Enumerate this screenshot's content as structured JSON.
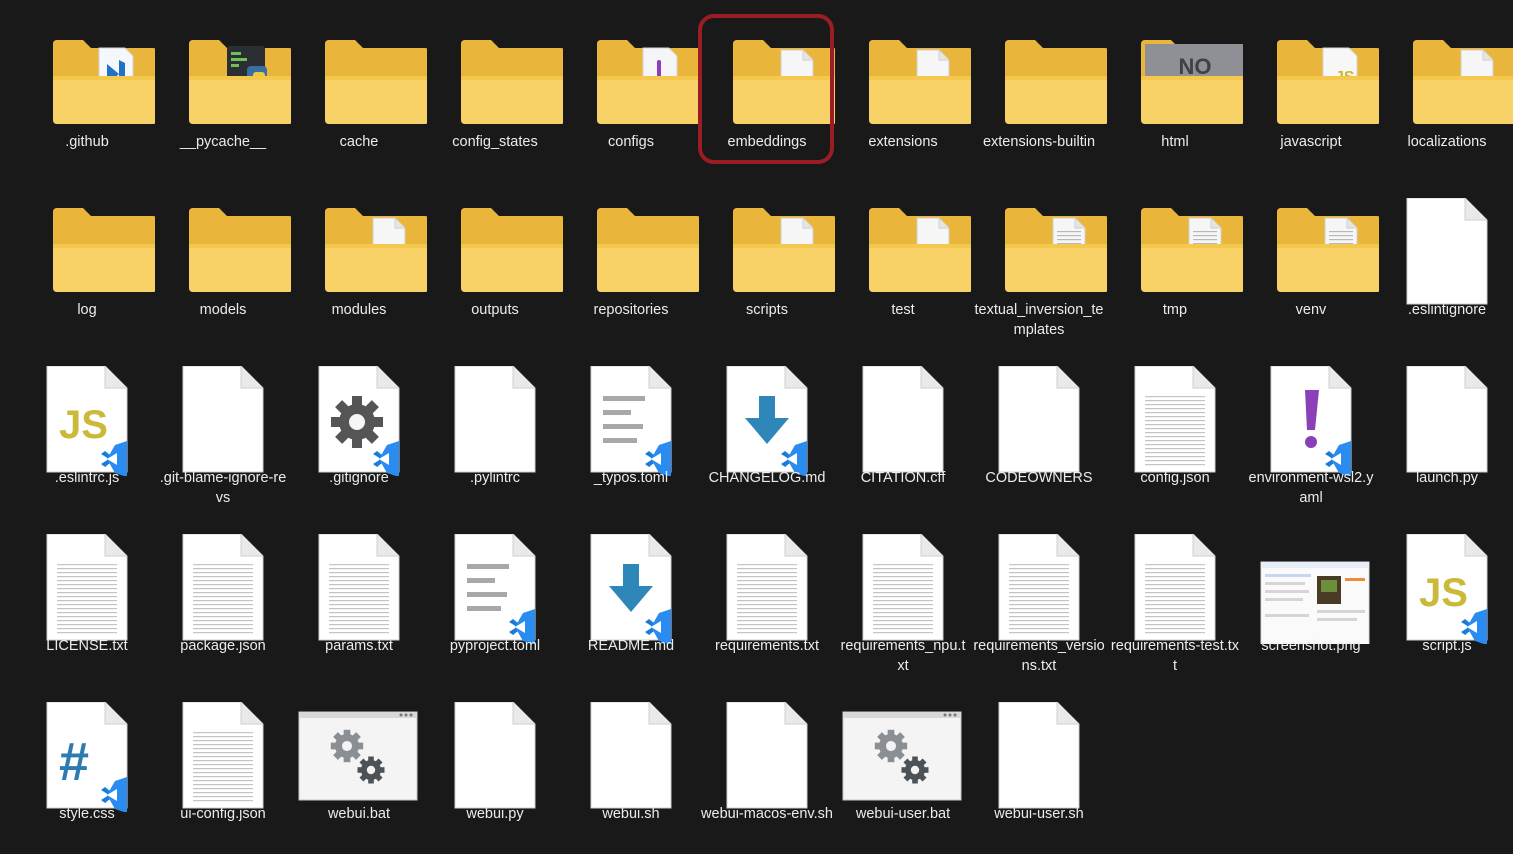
{
  "explorer": {
    "selected_item": "embeddings",
    "accent_ring_color": "#9b1c25",
    "items": [
      {
        "label": ".github",
        "icon": "folder-github-icon",
        "kind": "folder",
        "content": "vscode"
      },
      {
        "label": "__pycache__",
        "icon": "folder-pycache-icon",
        "kind": "folder",
        "content": "python"
      },
      {
        "label": "cache",
        "icon": "folder-icon",
        "kind": "folder",
        "content": "empty"
      },
      {
        "label": "config_states",
        "icon": "folder-icon",
        "kind": "folder",
        "content": "empty"
      },
      {
        "label": "configs",
        "icon": "folder-configs-icon",
        "kind": "folder",
        "content": "purple"
      },
      {
        "label": "embeddings",
        "icon": "folder-doc-icon",
        "kind": "folder",
        "content": "doc"
      },
      {
        "label": "extensions",
        "icon": "folder-doc-icon",
        "kind": "folder",
        "content": "doc"
      },
      {
        "label": "extensions-builtin",
        "icon": "folder-icon",
        "kind": "folder",
        "content": "empty"
      },
      {
        "label": "html",
        "icon": "folder-html-icon",
        "kind": "folder",
        "content": "no-image"
      },
      {
        "label": "javascript",
        "icon": "folder-js-icon",
        "kind": "folder",
        "content": "js"
      },
      {
        "label": "localizations",
        "icon": "folder-doc-icon",
        "kind": "folder",
        "content": "doc"
      },
      {
        "label": "log",
        "icon": "folder-icon",
        "kind": "folder",
        "content": "empty"
      },
      {
        "label": "models",
        "icon": "folder-icon",
        "kind": "folder",
        "content": "empty"
      },
      {
        "label": "modules",
        "icon": "folder-doc-icon",
        "kind": "folder",
        "content": "doc"
      },
      {
        "label": "outputs",
        "icon": "folder-icon",
        "kind": "folder",
        "content": "empty"
      },
      {
        "label": "repositories",
        "icon": "folder-icon",
        "kind": "folder",
        "content": "empty"
      },
      {
        "label": "scripts",
        "icon": "folder-doc-icon",
        "kind": "folder",
        "content": "doc"
      },
      {
        "label": "test",
        "icon": "folder-doc-icon",
        "kind": "folder",
        "content": "doc"
      },
      {
        "label": "textual_inversion_templates",
        "icon": "folder-doc-icon",
        "kind": "folder",
        "content": "lines"
      },
      {
        "label": "tmp",
        "icon": "folder-doc-icon",
        "kind": "folder",
        "content": "lines"
      },
      {
        "label": "venv",
        "icon": "folder-doc-icon",
        "kind": "folder",
        "content": "lines"
      },
      {
        "label": ".eslintignore",
        "icon": "blank-file-icon",
        "kind": "file",
        "content": "blank"
      },
      {
        "label": ".eslintrc.js",
        "icon": "js-file-icon",
        "kind": "file",
        "content": "js"
      },
      {
        "label": ".git-blame-ignore-revs",
        "icon": "blank-file-icon",
        "kind": "file",
        "content": "blank"
      },
      {
        "label": ".gitignore",
        "icon": "gear-file-icon",
        "kind": "file",
        "content": "gear"
      },
      {
        "label": ".pylintrc",
        "icon": "blank-file-icon",
        "kind": "file",
        "content": "blank"
      },
      {
        "label": "_typos.toml",
        "icon": "text-file-icon",
        "kind": "file",
        "content": "text"
      },
      {
        "label": "CHANGELOG.md",
        "icon": "markdown-file-icon",
        "kind": "file",
        "content": "download"
      },
      {
        "label": "CITATION.cff",
        "icon": "blank-file-icon",
        "kind": "file",
        "content": "blank"
      },
      {
        "label": "CODEOWNERS",
        "icon": "blank-file-icon",
        "kind": "file",
        "content": "blank"
      },
      {
        "label": "config.json",
        "icon": "lined-file-icon",
        "kind": "file",
        "content": "lines"
      },
      {
        "label": "environment-wsl2.yaml",
        "icon": "yaml-file-icon",
        "kind": "file",
        "content": "exclaim"
      },
      {
        "label": "launch.py",
        "icon": "blank-file-icon",
        "kind": "file",
        "content": "blank"
      },
      {
        "label": "LICENSE.txt",
        "icon": "lined-file-icon",
        "kind": "file",
        "content": "lines"
      },
      {
        "label": "package.json",
        "icon": "lined-file-icon",
        "kind": "file",
        "content": "lines"
      },
      {
        "label": "params.txt",
        "icon": "lined-file-icon",
        "kind": "file",
        "content": "lines"
      },
      {
        "label": "pyproject.toml",
        "icon": "text-file-icon",
        "kind": "file",
        "content": "text"
      },
      {
        "label": "README.md",
        "icon": "markdown-file-icon",
        "kind": "file",
        "content": "download"
      },
      {
        "label": "requirements.txt",
        "icon": "lined-file-icon",
        "kind": "file",
        "content": "lines"
      },
      {
        "label": "requirements_npu.txt",
        "icon": "lined-file-icon",
        "kind": "file",
        "content": "lines"
      },
      {
        "label": "requirements_versions.txt",
        "icon": "lined-file-icon",
        "kind": "file",
        "content": "lines"
      },
      {
        "label": "requirements-test.txt",
        "icon": "lined-file-icon",
        "kind": "file",
        "content": "lines"
      },
      {
        "label": "screenshot.png",
        "icon": "image-thumbnail-icon",
        "kind": "image",
        "content": "thumb"
      },
      {
        "label": "script.js",
        "icon": "js-file-icon",
        "kind": "file",
        "content": "js"
      },
      {
        "label": "style.css",
        "icon": "css-file-icon",
        "kind": "file",
        "content": "hash"
      },
      {
        "label": "ui-config.json",
        "icon": "lined-file-icon",
        "kind": "file",
        "content": "lines"
      },
      {
        "label": "webui.bat",
        "icon": "batch-file-icon",
        "kind": "file",
        "content": "batch"
      },
      {
        "label": "webui.py",
        "icon": "blank-file-icon",
        "kind": "file",
        "content": "blank"
      },
      {
        "label": "webui.sh",
        "icon": "blank-file-icon",
        "kind": "file",
        "content": "blank"
      },
      {
        "label": "webui-macos-env.sh",
        "icon": "blank-file-icon",
        "kind": "file",
        "content": "blank"
      },
      {
        "label": "webui-user.bat",
        "icon": "batch-file-icon",
        "kind": "file",
        "content": "batch"
      },
      {
        "label": "webui-user.sh",
        "icon": "blank-file-icon",
        "kind": "file",
        "content": "blank"
      }
    ]
  }
}
